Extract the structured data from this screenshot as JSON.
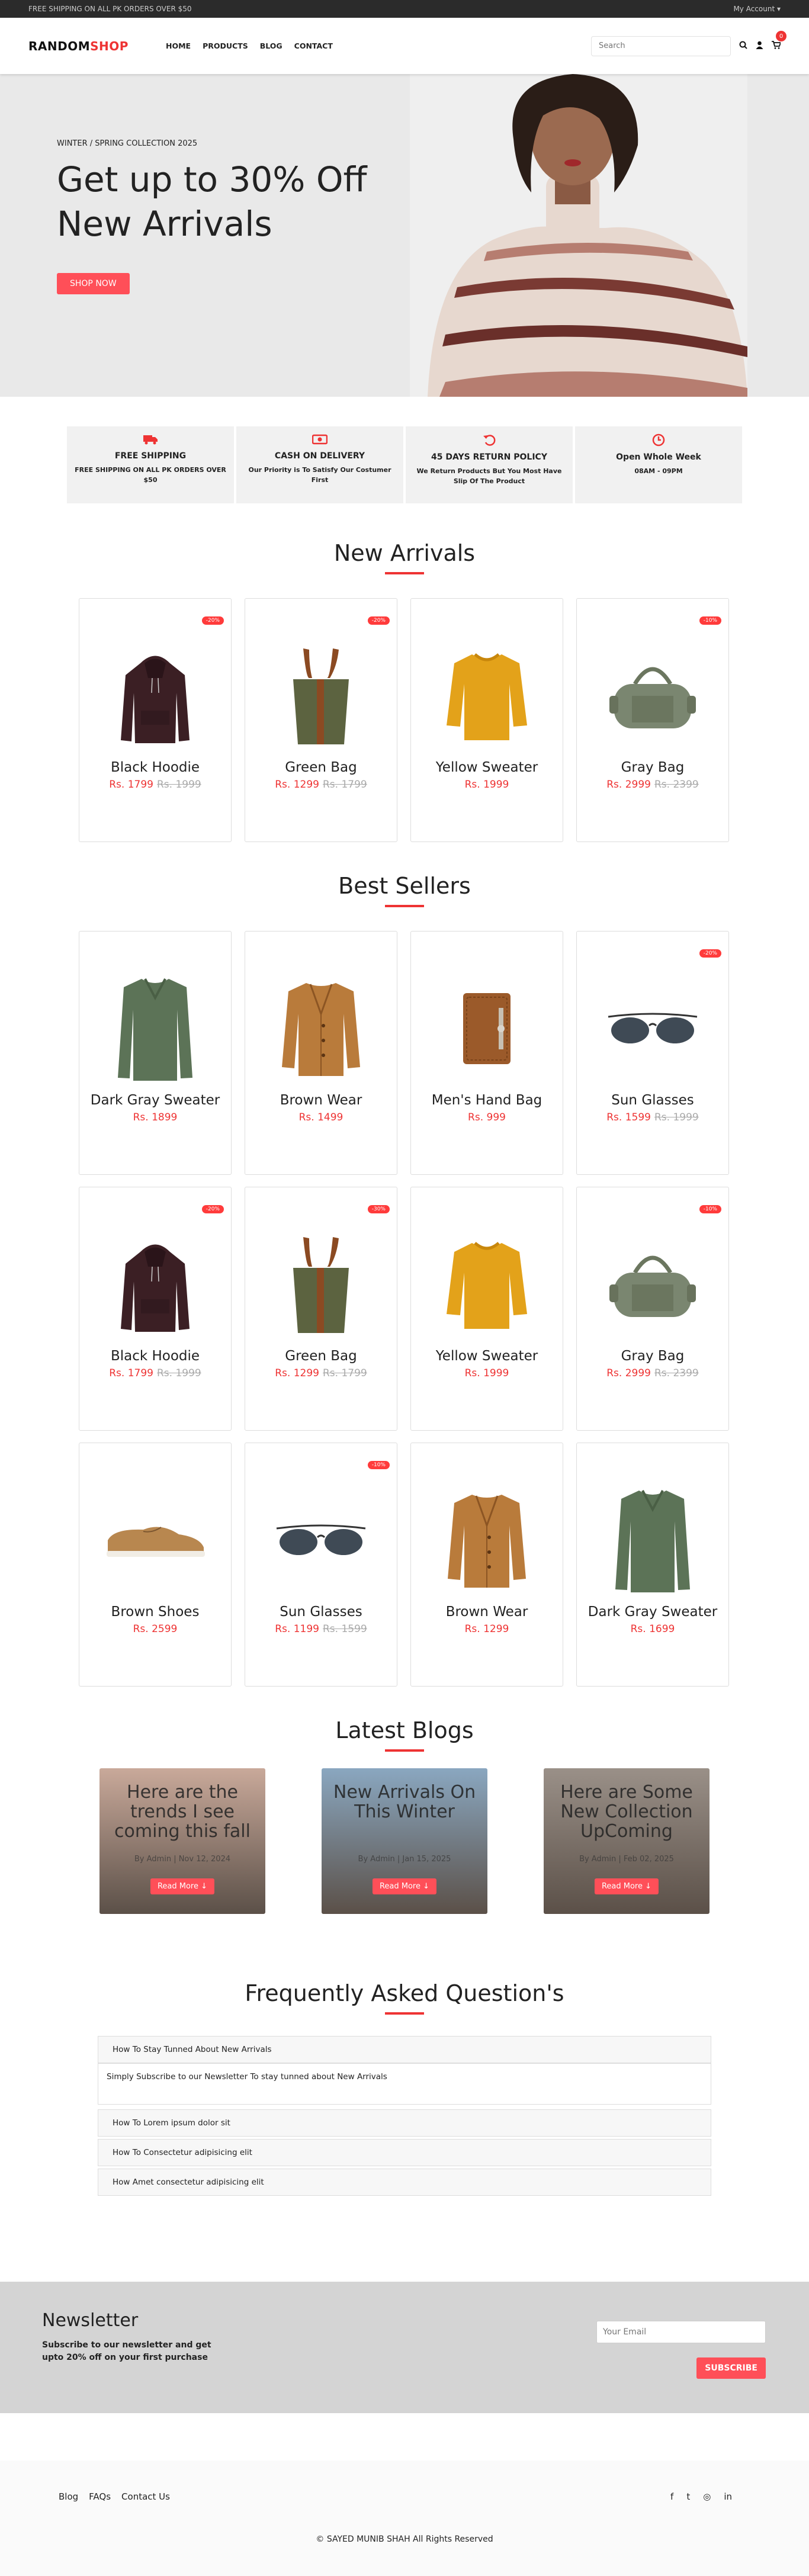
{
  "topbar": {
    "notice": "FREE SHIPPING ON ALL PK ORDERS OVER $50",
    "account": "My Account ▾"
  },
  "nav": {
    "logo_a": "RANDOM",
    "logo_b": "SHOP",
    "menu": [
      "HOME",
      "PRODUCTS",
      "BLOG",
      "CONTACT"
    ],
    "search_placeholder": "Search",
    "cart_count": "0"
  },
  "hero": {
    "subtitle": "WINTER / SPRING COLLECTION 2025",
    "title_1": "Get up to 30% Off",
    "title_2": "New Arrivals",
    "button": "SHOP NOW"
  },
  "features": [
    {
      "title": "FREE SHIPPING",
      "text": "FREE SHIPPING ON ALL PK ORDERS OVER $50",
      "icon": "truck-icon"
    },
    {
      "title": "CASH ON DELIVERY",
      "text": "Our Priority is To Satisfy Our Costumer First",
      "icon": "money-icon"
    },
    {
      "title": "45 DAYS RETURN POLICY",
      "text": "We Return Products But You Most Have Slip Of The Product",
      "icon": "return-icon"
    },
    {
      "title": "Open Whole Week",
      "text": "08AM - 09PM",
      "icon": "clock-icon"
    }
  ],
  "new_arrivals": {
    "title": "New Arrivals",
    "products": [
      {
        "name": "Black Hoodie",
        "price": "Rs. 1799",
        "old": "Rs. 1999",
        "badge": "-20%",
        "art": "hoodie"
      },
      {
        "name": "Green Bag",
        "price": "Rs. 1299",
        "old": "Rs. 1799",
        "badge": "-20%",
        "art": "bag"
      },
      {
        "name": "Yellow Sweater",
        "price": "Rs. 1999",
        "old": "",
        "badge": "",
        "art": "sweater"
      },
      {
        "name": "Gray Bag",
        "price": "Rs. 2999",
        "old": "Rs. 2399",
        "badge": "-10%",
        "art": "duffel"
      }
    ]
  },
  "best_sellers": {
    "title": "Best Sellers",
    "products": [
      {
        "name": "Dark Gray Sweater",
        "price": "Rs. 1899",
        "old": "",
        "badge": "",
        "art": "greensweater"
      },
      {
        "name": "Brown Wear",
        "price": "Rs. 1499",
        "old": "",
        "badge": "",
        "art": "jacket"
      },
      {
        "name": "Men's Hand Bag",
        "price": "Rs. 999",
        "old": "",
        "badge": "",
        "art": "wallet"
      },
      {
        "name": "Sun Glasses",
        "price": "Rs. 1599",
        "old": "Rs. 1999",
        "badge": "-20%",
        "art": "glasses"
      },
      {
        "name": "Black Hoodie",
        "price": "Rs. 1799",
        "old": "Rs. 1999",
        "badge": "-20%",
        "art": "hoodie"
      },
      {
        "name": "Green Bag",
        "price": "Rs. 1299",
        "old": "Rs. 1799",
        "badge": "-30%",
        "art": "bag"
      },
      {
        "name": "Yellow Sweater",
        "price": "Rs. 1999",
        "old": "",
        "badge": "",
        "art": "sweater"
      },
      {
        "name": "Gray Bag",
        "price": "Rs. 2999",
        "old": "Rs. 2399",
        "badge": "-10%",
        "art": "duffel"
      },
      {
        "name": "Brown Shoes",
        "price": "Rs. 2599",
        "old": "",
        "badge": "",
        "art": "shoe"
      },
      {
        "name": "Sun Glasses",
        "price": "Rs. 1199",
        "old": "Rs. 1599",
        "badge": "-10%",
        "art": "glasses"
      },
      {
        "name": "Brown Wear",
        "price": "Rs. 1299",
        "old": "",
        "badge": "",
        "art": "jacket"
      },
      {
        "name": "Dark Gray Sweater",
        "price": "Rs. 1699",
        "old": "",
        "badge": "",
        "art": "greensweater"
      }
    ]
  },
  "blogs": {
    "title": "Latest Blogs",
    "button": "Read More",
    "items": [
      {
        "title": "Here are the trends I see coming this fall",
        "by": "By Admin | Nov 12, 2024",
        "bg": "#c9a99a"
      },
      {
        "title": "New Arrivals On This Winter",
        "by": "By Admin | Jan 15, 2025",
        "bg": "#8aa7c0"
      },
      {
        "title": "Here are Some New Collection UpComing",
        "by": "By Admin | Feb 02, 2025",
        "bg": "#9a9088"
      }
    ]
  },
  "faq": {
    "title": "Frequently Asked Question's",
    "items": [
      {
        "q": "How To Stay Tunned About New Arrivals",
        "a": "Simply Subscribe to our Newsletter To stay tunned about New Arrivals"
      },
      {
        "q": "How To Lorem ipsum dolor sit",
        "a": ""
      },
      {
        "q": "How To Consectetur adipisicing elit",
        "a": ""
      },
      {
        "q": "How Amet consectetur adipisicing elit",
        "a": ""
      }
    ]
  },
  "newsletter": {
    "title": "Newsletter",
    "text": "Subscribe to our newsletter and get upto 20% off on your first purchase",
    "placeholder": "Your Email",
    "button": "SUBSCRIBE"
  },
  "footer": {
    "links": [
      "Blog",
      "FAQs",
      "Contact Us"
    ],
    "social": [
      "f",
      "t",
      "◎",
      "in"
    ],
    "copyright": "© SAYED MUNIB SHAH All Rights Reserved"
  },
  "colors": {
    "accent": "#ff3b3b",
    "hero_bg": "#e9e9e9",
    "newsletter_bg": "#d4d4d4"
  }
}
